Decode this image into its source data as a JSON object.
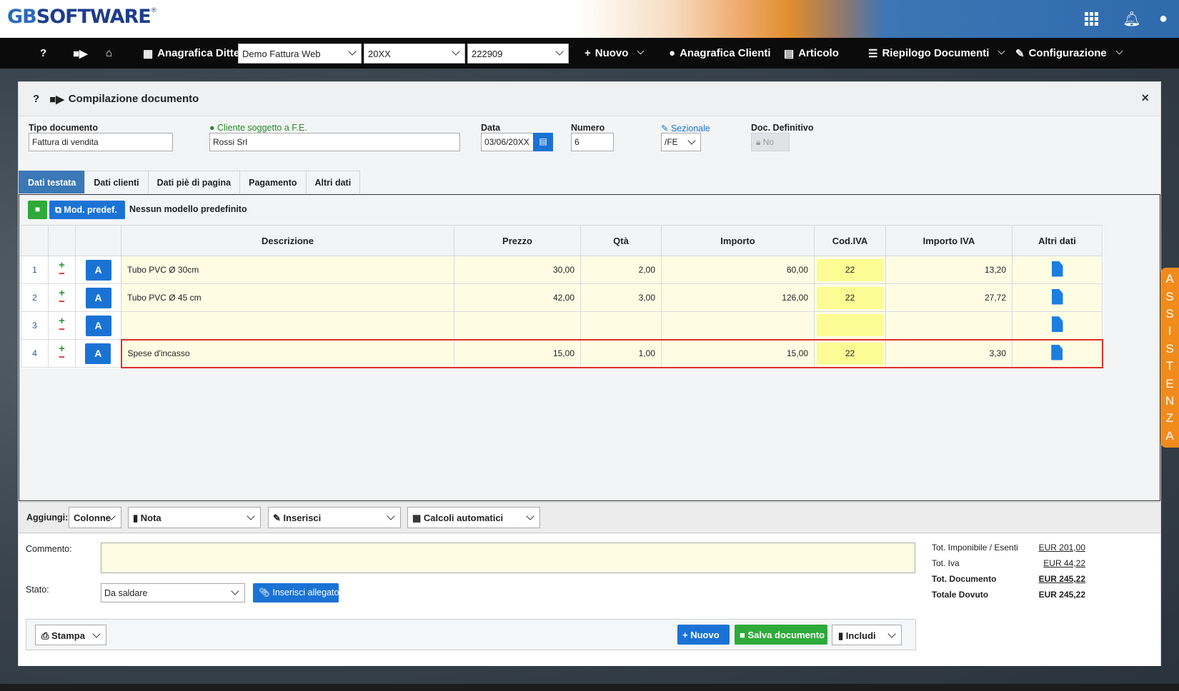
{
  "brand": {
    "logo_gb": "GB",
    "logo_rest": "SOFTWARE",
    "logo_reg": "®"
  },
  "topbar": {
    "icons": [
      "apps-grid-icon",
      "bell-icon",
      "user-circle-icon"
    ]
  },
  "nav": {
    "help": "?",
    "video": "video-icon",
    "home": "home-icon",
    "anagrafica_ditte": "Anagrafica Ditte",
    "company_select": "Demo Fattura Web",
    "year_select": "20XX",
    "code_select": "222909",
    "nuovo": "Nuovo",
    "anagrafica_clienti": "Anagrafica Clienti",
    "articolo": "Articolo",
    "riepilogo": "Riepilogo Documenti",
    "configurazione": "Configurazione"
  },
  "panel": {
    "title": "Compilazione documento",
    "help": "?",
    "close": "×",
    "fields": {
      "tipo_label": "Tipo documento",
      "tipo_value": "Fattura di vendita",
      "cliente_label": "Cliente soggetto a F.E.",
      "cliente_value": "Rossi Srl",
      "data_label": "Data",
      "data_value": "03/06/20XX",
      "numero_label": "Numero",
      "numero_value": "6",
      "sezionale_label": "Sezionale",
      "sezionale_value": "/FE",
      "definitivo_label": "Doc. Definitivo",
      "definitivo_value": "No"
    },
    "tabs": [
      "Dati testata",
      "Dati clienti",
      "Dati piè di pagina",
      "Pagamento",
      "Altri dati"
    ],
    "model": {
      "button": "Mod. predef.",
      "text": "Nessun modello predefinito"
    },
    "table": {
      "headers": [
        "",
        "",
        "",
        "Descrizione",
        "Prezzo",
        "Qtà",
        "Importo",
        "Cod.IVA",
        "Importo IVA",
        "Altri dati"
      ],
      "rows": [
        {
          "n": "1",
          "desc": "Tubo PVC Ø 30cm",
          "prezzo": "30,00",
          "qta": "2,00",
          "importo": "60,00",
          "iva": "22",
          "importo_iva": "13,20"
        },
        {
          "n": "2",
          "desc": "Tubo PVC Ø 45 cm",
          "prezzo": "42,00",
          "qta": "3,00",
          "importo": "126,00",
          "iva": "22",
          "importo_iva": "27,72"
        },
        {
          "n": "3",
          "desc": "",
          "prezzo": "",
          "qta": "",
          "importo": "",
          "iva": "",
          "importo_iva": ""
        },
        {
          "n": "4",
          "desc": "Spese d'incasso",
          "prezzo": "15,00",
          "qta": "1,00",
          "importo": "15,00",
          "iva": "22",
          "importo_iva": "3,30"
        }
      ],
      "a_label": "A",
      "plus": "+",
      "minus": "−"
    },
    "add": {
      "label": "Aggiungi:",
      "colonne": "Colonne",
      "nota": "Nota",
      "inserisci": "Inserisci",
      "calcoli": "Calcoli automatici"
    },
    "lower": {
      "commento_label": "Commento:",
      "stato_label": "Stato:",
      "stato_value": "Da saldare",
      "allegato": "Inserisci allegato",
      "totals": [
        {
          "label": "Tot. Imponibile / Esenti",
          "value": "EUR 201,00"
        },
        {
          "label": "Tot. Iva",
          "value": "EUR 44,22"
        },
        {
          "label": "Tot. Documento",
          "value": "EUR 245,22"
        },
        {
          "label": "Totale Dovuto",
          "value": "EUR 245,22"
        }
      ],
      "stampa": "Stampa",
      "nuovo": "Nuovo",
      "salva": "Salva documento",
      "includi": "Includi"
    }
  },
  "assistenza": [
    "A",
    "S",
    "S",
    "I",
    "S",
    "T",
    "E",
    "N",
    "Z",
    "A"
  ],
  "colors": {
    "accent": "#1a73d4",
    "success": "#2eaa3a",
    "tab_active": "#3b78b6",
    "row_bg": "#fefde4",
    "iva_bg": "#fcfc94",
    "highlight": "#e0302d",
    "assist": "#f08b1c"
  }
}
